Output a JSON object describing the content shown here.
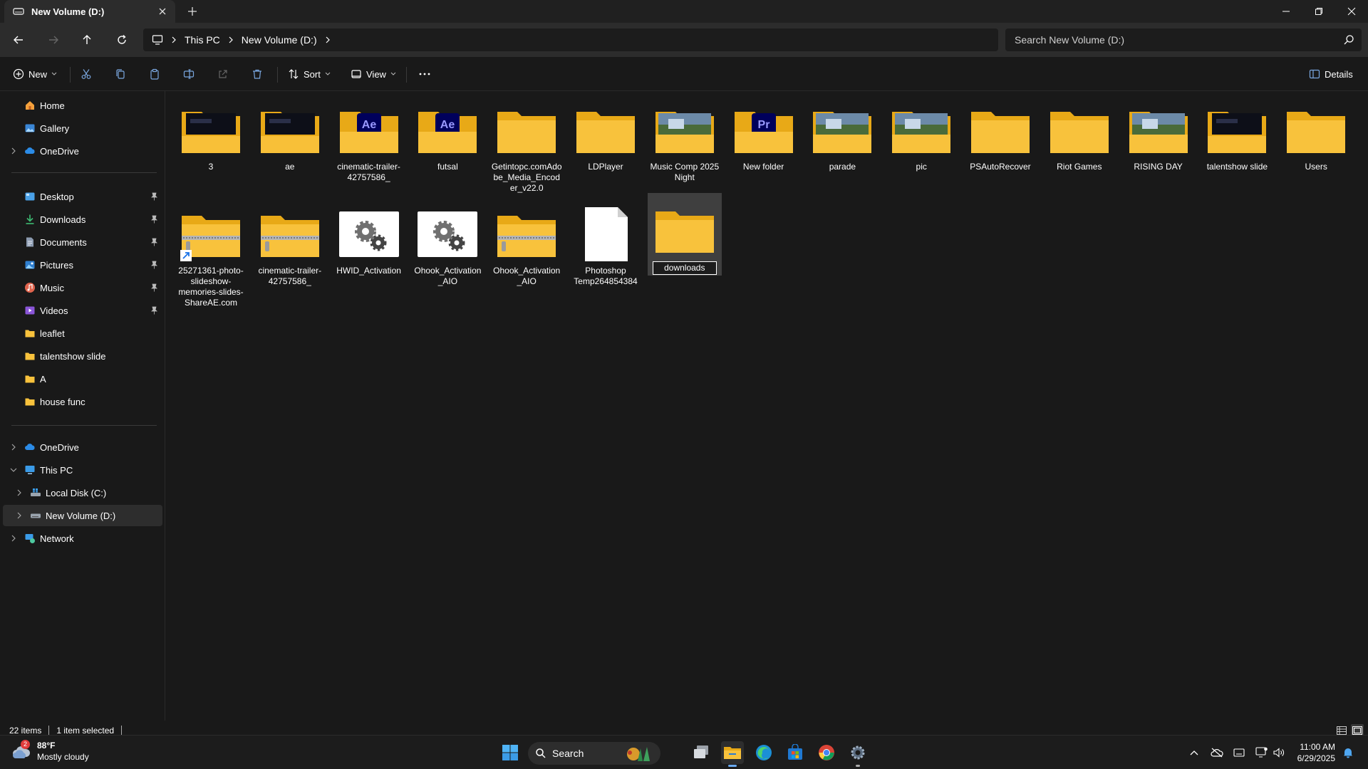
{
  "window": {
    "tab_title": "New Volume (D:)"
  },
  "address": {
    "breadcrumbs": [
      "This PC",
      "New Volume (D:)"
    ],
    "search_placeholder": "Search New Volume (D:)"
  },
  "toolbar": {
    "new_label": "New",
    "sort_label": "Sort",
    "view_label": "View",
    "details_label": "Details"
  },
  "sidebar": {
    "quick": [
      {
        "label": "Home",
        "icon": "home-icon"
      },
      {
        "label": "Gallery",
        "icon": "gallery-icon"
      },
      {
        "label": "OneDrive",
        "icon": "cloud-icon"
      }
    ],
    "pinned": [
      {
        "label": "Desktop",
        "icon": "desktop-icon"
      },
      {
        "label": "Downloads",
        "icon": "downloads-icon"
      },
      {
        "label": "Documents",
        "icon": "documents-icon"
      },
      {
        "label": "Pictures",
        "icon": "pictures-icon"
      },
      {
        "label": "Music",
        "icon": "music-icon"
      },
      {
        "label": "Videos",
        "icon": "videos-icon"
      },
      {
        "label": "leaflet",
        "icon": "folder-icon"
      },
      {
        "label": "talentshow slide",
        "icon": "folder-icon"
      },
      {
        "label": "A",
        "icon": "folder-icon"
      },
      {
        "label": "house func",
        "icon": "folder-icon"
      }
    ],
    "tree": [
      {
        "label": "OneDrive",
        "icon": "cloud-icon"
      },
      {
        "label": "This PC",
        "icon": "pc-icon"
      },
      {
        "label": "Local Disk (C:)",
        "icon": "drive-icon"
      },
      {
        "label": "New Volume (D:)",
        "icon": "drive-icon"
      },
      {
        "label": "Network",
        "icon": "network-icon"
      }
    ]
  },
  "files": {
    "row1": [
      {
        "name": "3",
        "kind": "folder-dark"
      },
      {
        "name": "ae",
        "kind": "folder-dark"
      },
      {
        "name": "cinematic-trailer-42757586_",
        "kind": "folder-ae"
      },
      {
        "name": "futsal",
        "kind": "folder-ae"
      },
      {
        "name": "Getintopc.comAdobe_Media_Encoder_v22.0",
        "kind": "folder"
      },
      {
        "name": "LDPlayer",
        "kind": "folder"
      },
      {
        "name": "Music Comp 2025 Night",
        "kind": "folder-photo"
      },
      {
        "name": "New folder",
        "kind": "folder-pr"
      },
      {
        "name": "parade",
        "kind": "folder-photo"
      },
      {
        "name": "pic",
        "kind": "folder-photo"
      },
      {
        "name": "PSAutoRecover",
        "kind": "folder"
      },
      {
        "name": "Riot Games",
        "kind": "folder"
      },
      {
        "name": "RISING DAY",
        "kind": "folder-photo"
      },
      {
        "name": "talentshow slide",
        "kind": "folder-dark"
      },
      {
        "name": "Users",
        "kind": "folder"
      }
    ],
    "row2": [
      {
        "name": "25271361-photo-slideshow-memories-slides-ShareAE.com",
        "kind": "zip-shortcut"
      },
      {
        "name": "cinematic-trailer-42757586_",
        "kind": "zip"
      },
      {
        "name": "HWID_Activation",
        "kind": "script"
      },
      {
        "name": "Ohook_Activation_AIO",
        "kind": "script"
      },
      {
        "name": "Ohook_Activation_AIO",
        "kind": "zip"
      },
      {
        "name": "Photoshop Temp264854384",
        "kind": "file"
      },
      {
        "name": "downloads",
        "kind": "folder-selected"
      }
    ],
    "ae_badge": "Ae",
    "pr_badge": "Pr"
  },
  "status": {
    "count": "22 items",
    "selection": "1 item selected"
  },
  "taskbar": {
    "temperature": "88°F",
    "condition": "Mostly cloudy",
    "weather_badge": "2",
    "search_label": "Search",
    "time": "11:00 AM",
    "date": "6/29/2025"
  },
  "colors": {
    "folder": "#f8c23c",
    "folder_back": "#e8a917",
    "accent": "#3b8eea",
    "selection": "#3f3f3f"
  }
}
